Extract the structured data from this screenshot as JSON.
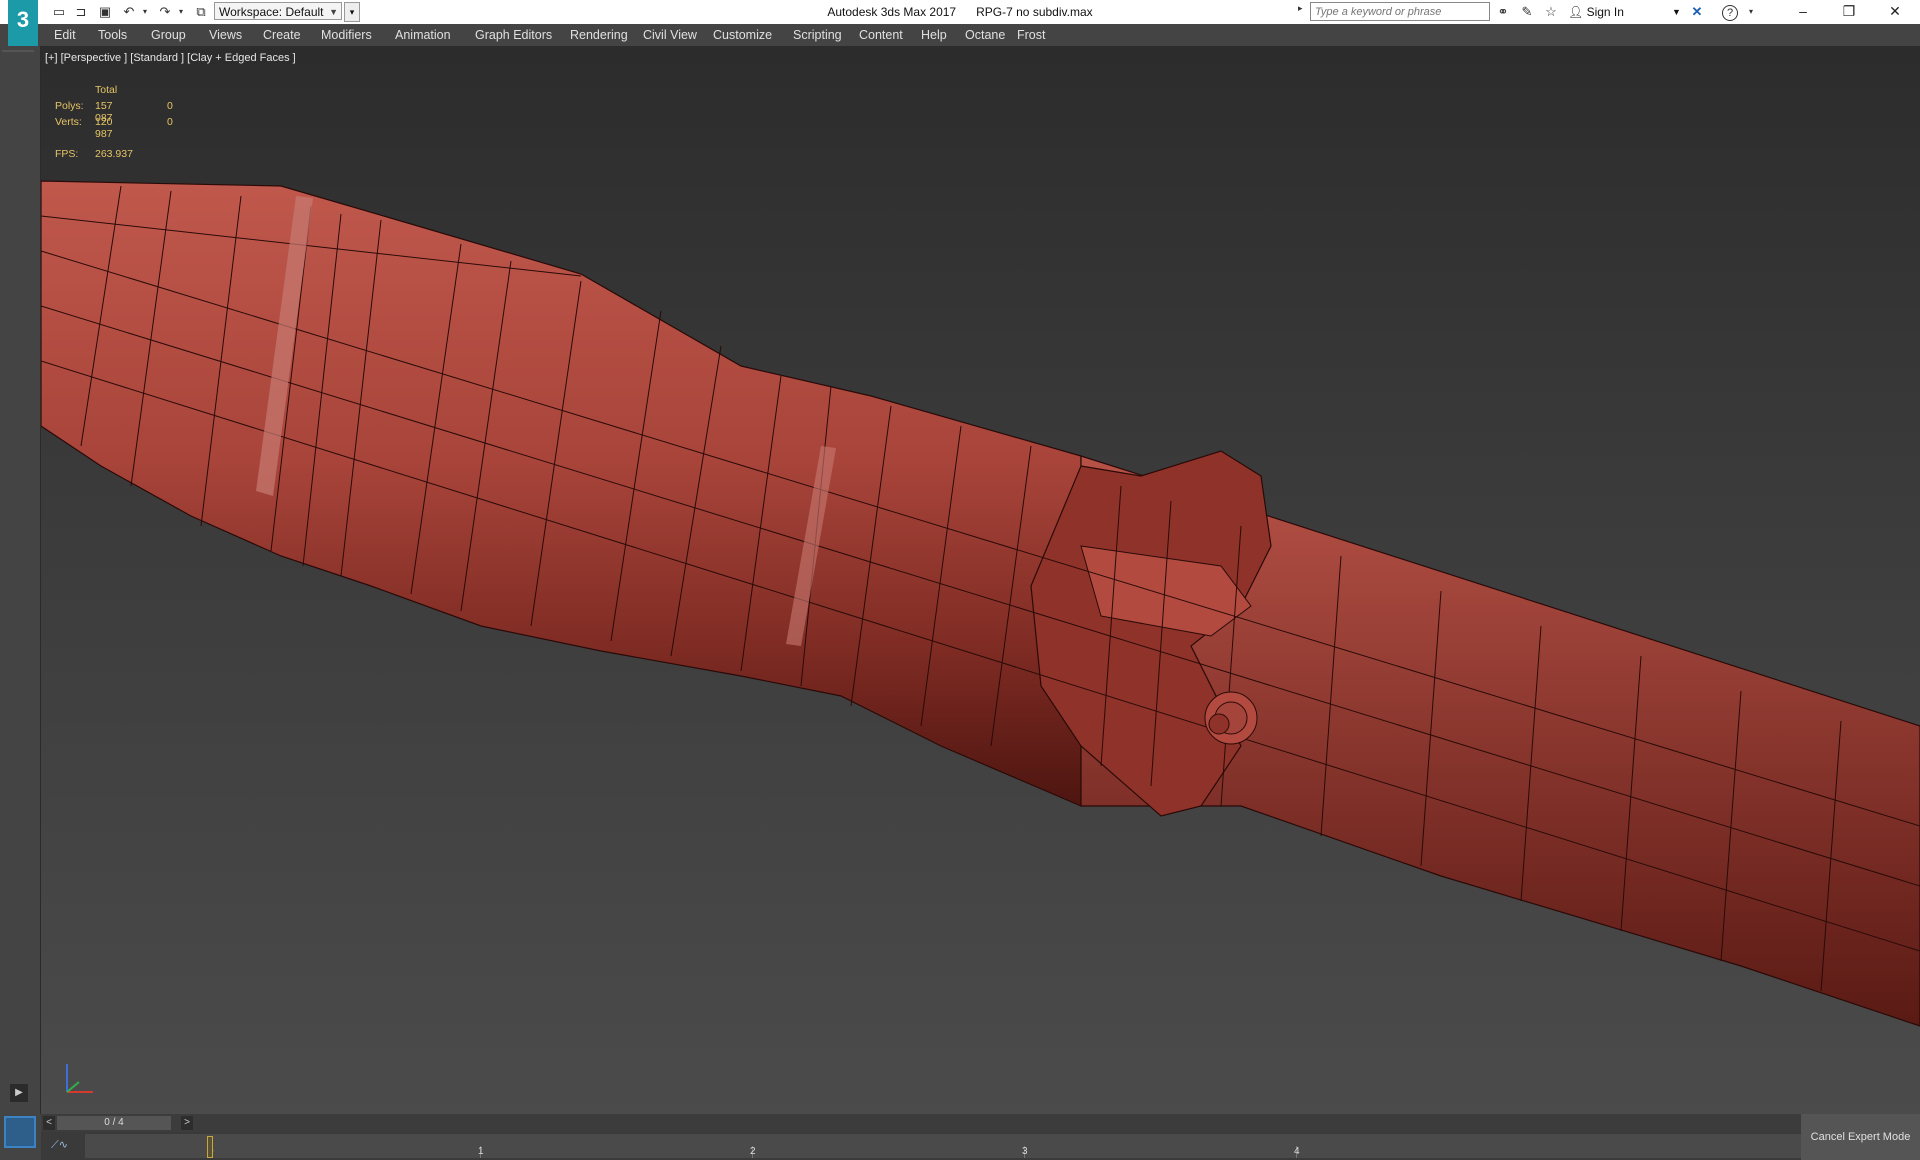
{
  "titlebar": {
    "logo": "3",
    "workspace": "Workspace: Default",
    "app_name": "Autodesk 3ds Max 2017",
    "file_name": "RPG-7 no subdiv.max",
    "search_placeholder": "Type a keyword or phrase",
    "sign_in": "Sign In",
    "icons": [
      "new-file-icon",
      "open-file-icon",
      "save-icon",
      "undo-icon",
      "redo-icon",
      "project-icon",
      "binoculars-icon",
      "star-icon",
      "user-icon",
      "x-icon",
      "help-icon"
    ],
    "window_controls": {
      "minimize": "–",
      "restore": "❐",
      "close": "✕"
    }
  },
  "menu": {
    "items": [
      "Edit",
      "Tools",
      "Group",
      "Views",
      "Create",
      "Modifiers",
      "Animation",
      "Graph Editors",
      "Rendering",
      "Civil View",
      "Customize",
      "Scripting",
      "Content",
      "Help",
      "Octane",
      "Frost"
    ]
  },
  "viewport": {
    "label": "[+] [Perspective ] [Standard ] [Clay + Edged Faces ]",
    "stats": {
      "header": "Total",
      "polys_label": "Polys:",
      "polys_total": "157 087",
      "polys_sel": "0",
      "verts_label": "Verts:",
      "verts_total": "120 987",
      "verts_sel": "0",
      "fps_label": "FPS:",
      "fps": "263.937"
    },
    "model_color": "#a8443a"
  },
  "timeline": {
    "frame_counter": "0 / 4",
    "prev": "<",
    "next": ">",
    "ticks": [
      "0",
      "1",
      "2",
      "3",
      "4"
    ],
    "curve_icon": "curve-editor-icon"
  },
  "cancel_expert": "Cancel Expert Mode",
  "colors": {
    "accent": "#c8a640",
    "stats_text": "#e6c566",
    "model": "#a8443a"
  }
}
